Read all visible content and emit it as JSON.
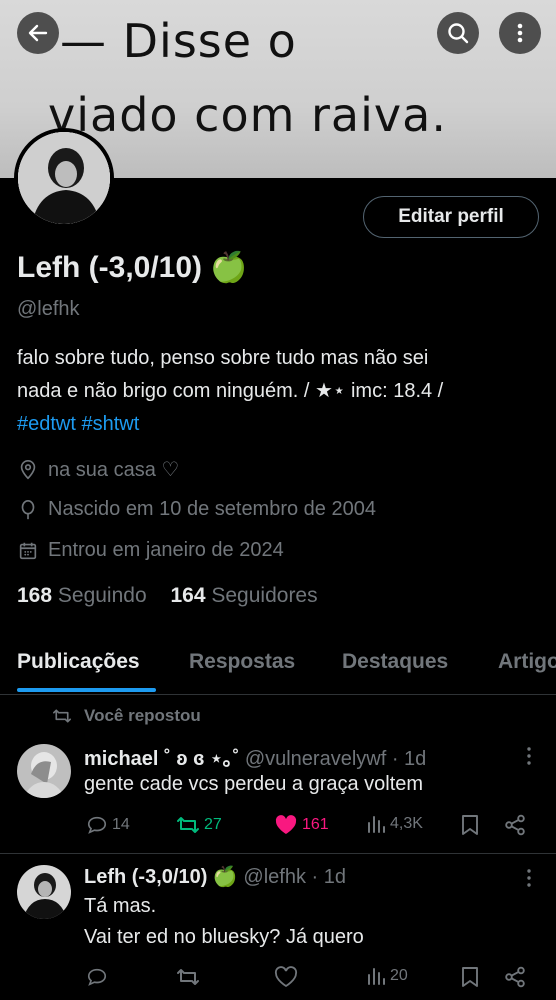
{
  "banner": {
    "line1": "— Disse o",
    "line2": "viado com raiva."
  },
  "header": {
    "back_icon": "back-arrow-icon",
    "search_icon": "search-icon",
    "more_icon": "more-vertical-icon"
  },
  "profile": {
    "edit_label": "Editar perfil",
    "name": "Lefh (-3,0/10) 🍏",
    "handle": "@lefhk",
    "bio_line1": "falo sobre tudo, penso sobre tudo mas não sei",
    "bio_line2": "nada e não brigo com ninguém.  /  ★⋆ imc: 18.4 /",
    "hashtags": [
      "#edtwt",
      "#shtwt"
    ],
    "location": "na sua casa ♡",
    "birth": "Nascido em 10 de setembro de 2004",
    "joined": "Entrou em janeiro de 2024",
    "following_count": "168",
    "following_label": "Seguindo",
    "followers_count": "164",
    "followers_label": "Seguidores"
  },
  "tabs": [
    "Publicações",
    "Respostas",
    "Destaques",
    "Artigos"
  ],
  "active_tab": "Publicações",
  "posts": [
    {
      "repost_label": "Você repostou",
      "author": "michael ˚ ʚ ɞ ⋆｡˚",
      "handle_time": "@vulneravelywf · 1d",
      "text": "gente cade vcs perdeu a graça voltem",
      "replies": "14",
      "reposts": "27",
      "likes": "161",
      "views": "4,3K"
    },
    {
      "author": "Lefh (-3,0/10) 🍏",
      "handle_time": "@lefhk · 1d",
      "text_line1": "Tá mas.",
      "text_line2": "Vai ter ed no bluesky? Já quero",
      "replies": "",
      "reposts": "",
      "likes": "",
      "views": "20"
    }
  ],
  "colors": {
    "accent": "#1d9bf0",
    "repost_green": "#00ba7c",
    "like_pink": "#f91880",
    "muted": "#71767b",
    "border": "#2f3336"
  }
}
